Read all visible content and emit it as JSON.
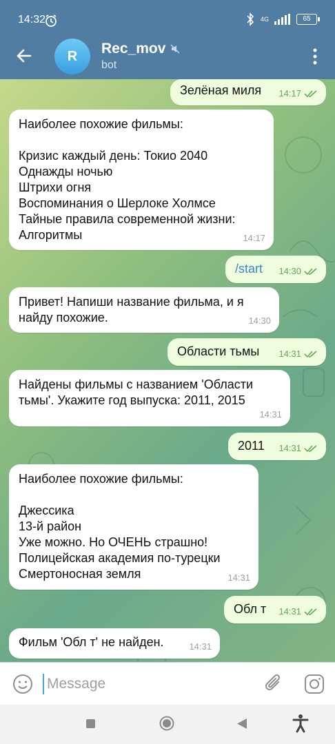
{
  "status_bar": {
    "time": "14:32",
    "network": "4G",
    "battery": "65"
  },
  "header": {
    "avatar_letter": "R",
    "title": "Rec_mov",
    "subtitle": "bot"
  },
  "messages": [
    {
      "text": "Зелёная миля",
      "time": "14:17",
      "direction": "out"
    },
    {
      "text": "Наиболее похожие фильмы:\n\nКризис каждый день: Токио 2040\nОднажды ночью\nШтрихи огня\nВоспоминания о Шерлоке Холмсе\nТайные правила современной жизни:\nАлгоритмы",
      "time": "14:17",
      "direction": "in"
    },
    {
      "text": "/start",
      "time": "14:30",
      "direction": "out"
    },
    {
      "text": "Привет! Напиши название фильма, и я\nнайду похожие.",
      "time": "14:30",
      "direction": "in"
    },
    {
      "text": "Области тьмы",
      "time": "14:31",
      "direction": "out"
    },
    {
      "text": "Найдены фильмы с названием 'Области\nтьмы'. Укажите год выпуска: 2011, 2015",
      "time": "14:31",
      "direction": "in"
    },
    {
      "text": "2011",
      "time": "14:31",
      "direction": "out"
    },
    {
      "text": "Наиболее похожие фильмы:\n\nДжессика\n13-й район\nУже можно. Но ОЧЕНЬ страшно!\nПолицейская академия по-турецки\nСмертоносная земля",
      "time": "14:31",
      "direction": "in"
    },
    {
      "text": "Обл т",
      "time": "14:31",
      "direction": "out"
    },
    {
      "text": "Фильм 'Обл т' не найден.",
      "time": "14:31",
      "direction": "in"
    }
  ],
  "input": {
    "placeholder": "Message",
    "value": ""
  },
  "colors": {
    "header": "#527da3",
    "outgoing_bubble": "#effdde",
    "incoming_bubble": "#ffffff",
    "check_color": "#5fa856",
    "link": "#3a86c9"
  },
  "icons": [
    "back-arrow-icon",
    "mute-icon",
    "more-vert-icon",
    "emoji-icon",
    "attach-icon",
    "camera-icon",
    "nav-square-icon",
    "nav-home-icon",
    "nav-back-icon",
    "accessibility-icon",
    "alarm-icon",
    "bluetooth-icon",
    "signal-icon",
    "battery-icon",
    "double-check-icon"
  ]
}
